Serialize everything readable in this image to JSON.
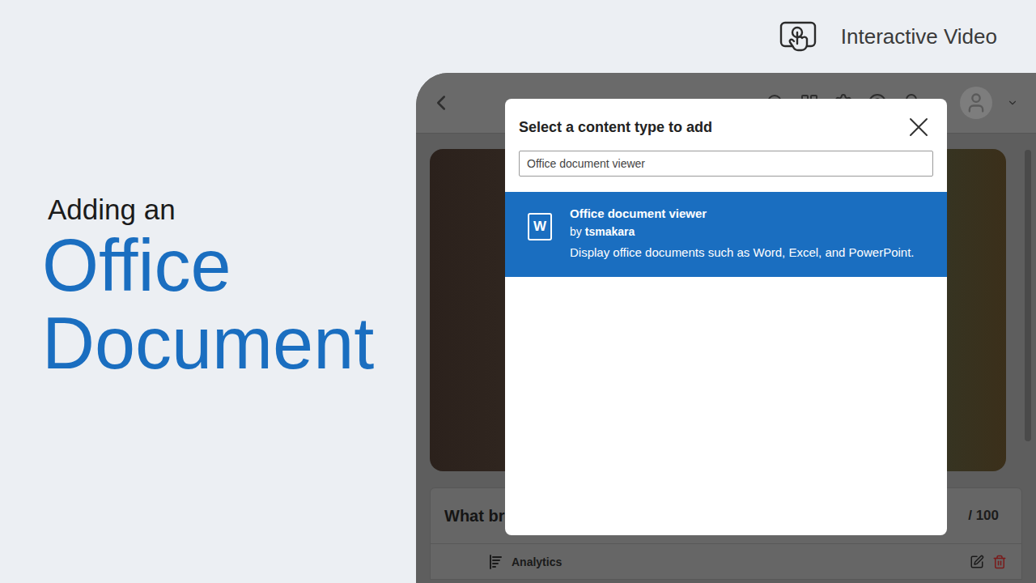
{
  "banner": {
    "kicker": "Adding an",
    "title_lines": [
      "Office",
      "Document"
    ]
  },
  "badge": {
    "label": "Interactive Video"
  },
  "dialog": {
    "title": "Select a content type to add",
    "search": {
      "value": "Office document viewer"
    },
    "results": [
      {
        "icon_glyph": "W",
        "title": "Office document viewer",
        "author_prefix": "by",
        "author": "tsmakara",
        "description": "Display office documents such as Word, Excel, and PowerPoint.",
        "selected": true
      }
    ]
  },
  "background_app": {
    "question": {
      "title": "What bro",
      "points": "/ 100"
    },
    "analytics": "Analytics"
  }
}
